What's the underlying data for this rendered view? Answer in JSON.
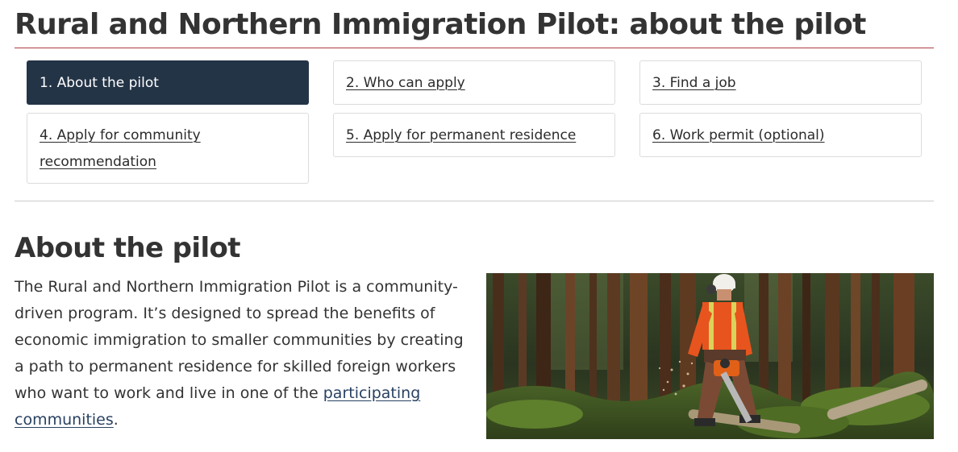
{
  "page": {
    "title": "Rural and Northern Immigration Pilot: about the pilot"
  },
  "steps": [
    {
      "label": "1. About the pilot",
      "active": true
    },
    {
      "label": "2. Who can apply",
      "active": false
    },
    {
      "label": "3. Find a job",
      "active": false
    },
    {
      "label": "4. Apply for community recommendation",
      "active": false
    },
    {
      "label": "5. Apply for permanent residence",
      "active": false
    },
    {
      "label": "6. Work permit (optional)",
      "active": false
    }
  ],
  "section": {
    "heading": "About the pilot",
    "intro_text": "The Rural and Northern Immigration Pilot is a community-driven program. It’s designed to spread the benefits of economic immigration to smaller communities by creating a path to permanent residence for skilled foreign workers who want to work and live in one of the",
    "intro_link": "participating communities",
    "intro_end": "."
  },
  "image": {
    "subject": "forestry-worker-with-chainsaw-photo"
  },
  "colors": {
    "active_step_bg": "#243447",
    "title_rule": "#af3c43",
    "link": "#284162"
  }
}
